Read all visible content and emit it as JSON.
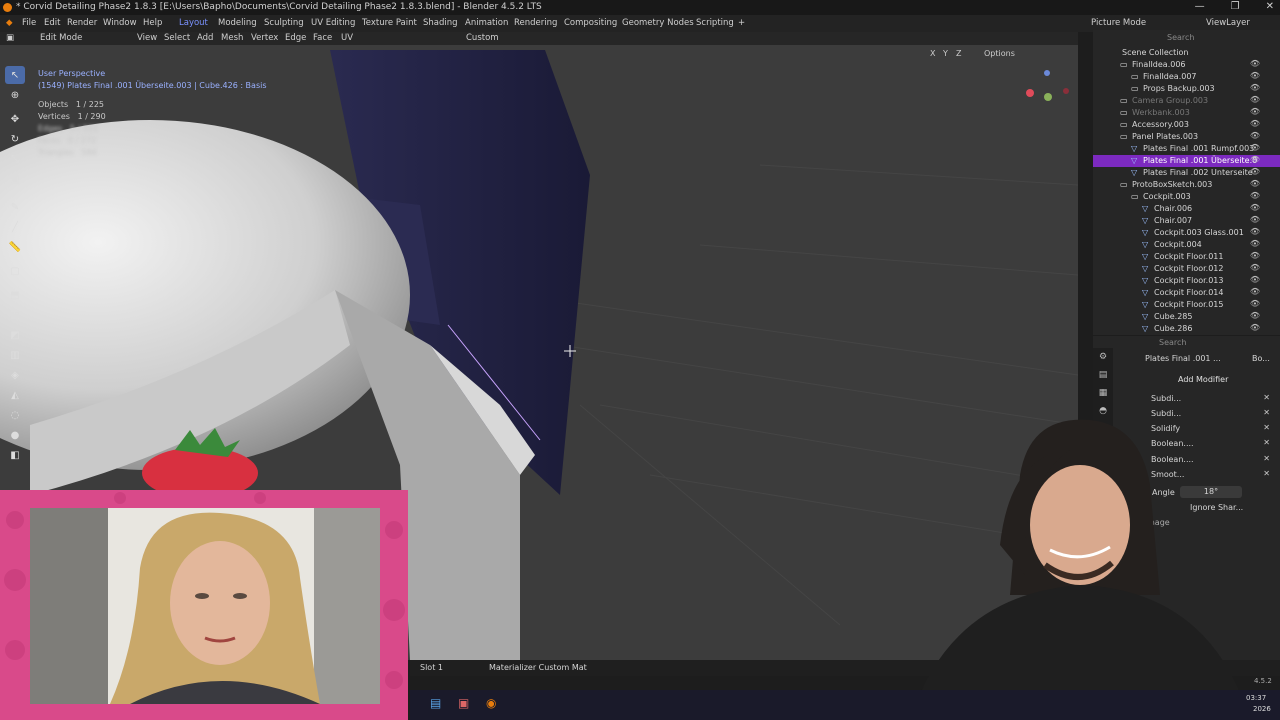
{
  "window": {
    "title": "* Corvid Detailing Phase2 1.8.3 [E:\\Users\\Bapho\\Documents\\Corvid Detailing Phase2 1.8.3.blend] - Blender 4.5.2 LTS",
    "controls": [
      "—",
      "❐",
      "✕"
    ]
  },
  "menu": [
    "File",
    "Edit",
    "Render",
    "Window",
    "Help"
  ],
  "workspaces": [
    {
      "label": "Layout",
      "active": true
    },
    {
      "label": "Modeling"
    },
    {
      "label": "Sculpting"
    },
    {
      "label": "UV Editing"
    },
    {
      "label": "Texture Paint"
    },
    {
      "label": "Shading"
    },
    {
      "label": "Animation"
    },
    {
      "label": "Rendering"
    },
    {
      "label": "Compositing"
    },
    {
      "label": "Geometry Nodes"
    },
    {
      "label": "Scripting"
    }
  ],
  "add_workspace": "+",
  "topright": {
    "picture_mode": "Picture Mode",
    "view_layer": "ViewLayer",
    "search_placeholder": "Search"
  },
  "header3d": {
    "mode": "Edit Mode",
    "menus": [
      "View",
      "Select",
      "Add",
      "Mesh",
      "Vertex",
      "Edge",
      "Face",
      "UV"
    ],
    "orientation": "Custom",
    "options": "Options",
    "axes": [
      "X",
      "Y",
      "Z"
    ]
  },
  "viewport": {
    "view_name": "User Perspective",
    "object_info": "(1549) Plates Final .001 Überseite.003 | Cube.426 : Basis",
    "stats": [
      {
        "label": "Objects",
        "value": "1 / 225"
      },
      {
        "label": "Vertices",
        "value": "1 / 290"
      },
      {
        "label": "Edges",
        "value": "5 / 551"
      },
      {
        "label": "Faces",
        "value": "0 / 272"
      },
      {
        "label": "Triangles",
        "value": "584"
      }
    ]
  },
  "outliner": {
    "title": "Scene Collection",
    "rows": [
      {
        "label": "FinalIdea.006",
        "indent": 1,
        "type": "coll"
      },
      {
        "label": "FinalIdea.007",
        "indent": 2,
        "type": "coll"
      },
      {
        "label": "Props Backup.003",
        "indent": 2,
        "type": "coll"
      },
      {
        "label": "Camera Group.003",
        "indent": 1,
        "type": "coll",
        "dim": true
      },
      {
        "label": "Werkbank.003",
        "indent": 1,
        "type": "coll",
        "dim": true
      },
      {
        "label": "Accessory.003",
        "indent": 1,
        "type": "coll"
      },
      {
        "label": "Panel Plates.003",
        "indent": 1,
        "type": "coll"
      },
      {
        "label": "Plates Final .001 Rumpf.003",
        "indent": 2,
        "type": "mesh"
      },
      {
        "label": "Plates Final .001 Überseite.0",
        "indent": 2,
        "type": "mesh",
        "selected": true
      },
      {
        "label": "Plates Final .002 Unterseite",
        "indent": 2,
        "type": "mesh"
      },
      {
        "label": "ProtoBoxSketch.003",
        "indent": 1,
        "type": "coll"
      },
      {
        "label": "Cockpit.003",
        "indent": 2,
        "type": "coll"
      },
      {
        "label": "Chair.006",
        "indent": 3,
        "type": "mesh"
      },
      {
        "label": "Chair.007",
        "indent": 3,
        "type": "mesh"
      },
      {
        "label": "Cockpit.003 Glass.001",
        "indent": 3,
        "type": "mesh"
      },
      {
        "label": "Cockpit.004",
        "indent": 3,
        "type": "mesh"
      },
      {
        "label": "Cockpit Floor.011",
        "indent": 3,
        "type": "mesh"
      },
      {
        "label": "Cockpit Floor.012",
        "indent": 3,
        "type": "mesh"
      },
      {
        "label": "Cockpit Floor.013",
        "indent": 3,
        "type": "mesh"
      },
      {
        "label": "Cockpit Floor.014",
        "indent": 3,
        "type": "mesh"
      },
      {
        "label": "Cockpit Floor.015",
        "indent": 3,
        "type": "mesh"
      },
      {
        "label": "Cube.285",
        "indent": 3,
        "type": "mesh"
      },
      {
        "label": "Cube.286",
        "indent": 3,
        "type": "mesh"
      }
    ]
  },
  "properties": {
    "search_placeholder": "Search",
    "object": "Plates Final .001 ...",
    "object_data": "Bo...",
    "add_modifier": "Add Modifier",
    "modifiers": [
      "Subdi...",
      "Subdi...",
      "Solidify",
      "Boolean....",
      "Boolean....",
      "Smoot..."
    ],
    "angle_label": "Angle",
    "angle_value": "18°",
    "ignore_sharp": "Ignore Shar...",
    "image_label": "mage"
  },
  "statusbar": {
    "slot": "Slot 1",
    "material": "Materializer Custom Mat"
  },
  "taskbar": {
    "time": "03:37",
    "date": "2026",
    "version": "4.5.2"
  },
  "colors": {
    "accent": "#7a92ff",
    "selection": "#7c2ac0",
    "webcam_frame": "#d94a8a"
  }
}
